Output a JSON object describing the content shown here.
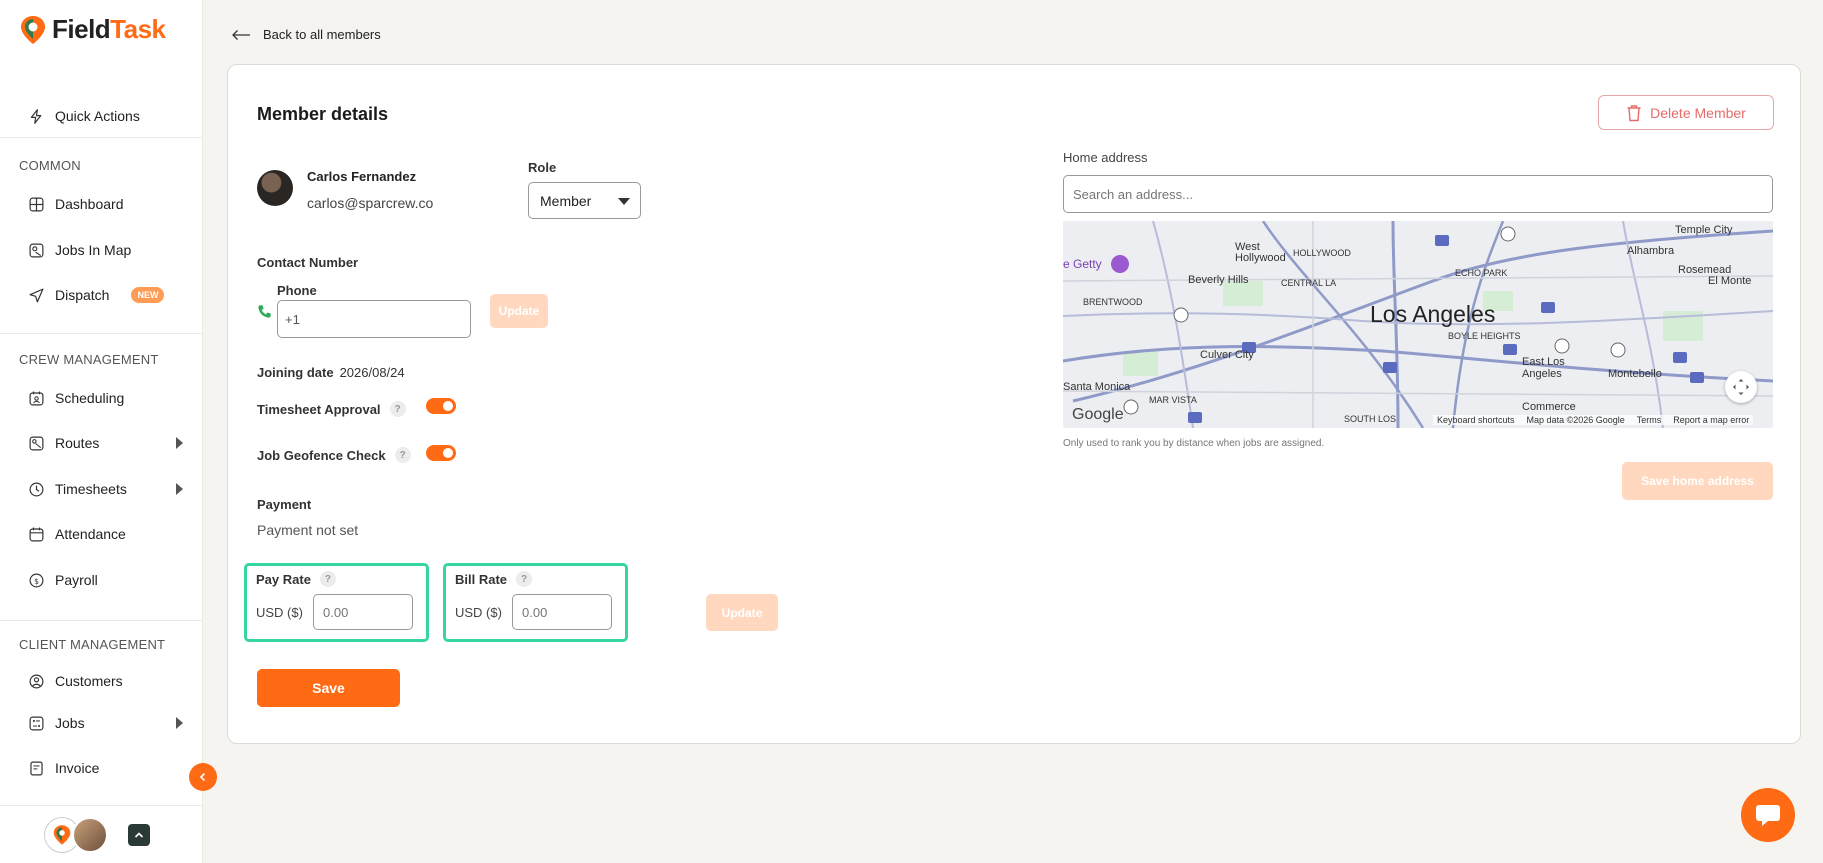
{
  "app": {
    "logo_text_a": "Field",
    "logo_text_b": "Task"
  },
  "sidebar": {
    "quick_actions": "Quick Actions",
    "sections": {
      "common": "COMMON",
      "crew": "CREW MANAGEMENT",
      "client": "CLIENT MANAGEMENT"
    },
    "items": {
      "dashboard": "Dashboard",
      "jobs_in_map": "Jobs In Map",
      "dispatch": "Dispatch",
      "dispatch_badge": "NEW",
      "scheduling": "Scheduling",
      "routes": "Routes",
      "timesheets": "Timesheets",
      "attendance": "Attendance",
      "payroll": "Payroll",
      "customers": "Customers",
      "jobs": "Jobs",
      "invoice": "Invoice"
    }
  },
  "main": {
    "back_link": "Back to all members",
    "title": "Member details",
    "delete_label": "Delete Member",
    "member": {
      "name": "Carlos Fernandez",
      "email": "carlos@sparcrew.co"
    },
    "role": {
      "label": "Role",
      "value": "Member"
    },
    "contact": {
      "label": "Contact Number",
      "phone_label": "Phone",
      "phone_value": "+1",
      "update_label": "Update"
    },
    "joining": {
      "label": "Joining date",
      "value": "2026/08/24"
    },
    "timesheet_approval": {
      "label": "Timesheet Approval",
      "enabled": true
    },
    "job_geofence": {
      "label": "Job Geofence Check",
      "enabled": true
    },
    "payment": {
      "label": "Payment",
      "status": "Payment not set",
      "pay_rate_label": "Pay Rate",
      "bill_rate_label": "Bill Rate",
      "currency": "USD ($)",
      "pay_placeholder": "0.00",
      "bill_placeholder": "0.00",
      "update_label": "Update"
    },
    "save_label": "Save",
    "home": {
      "label": "Home address",
      "placeholder": "Search an address...",
      "note": "Only used to rank you by distance when jobs are assigned.",
      "save_label": "Save home address"
    },
    "map": {
      "city": "Los Angeles",
      "places": [
        "Temple City",
        "West Hollywood",
        "HOLLYWOOD",
        "Alhambra",
        "ECHO PARK",
        "Rosemead",
        "e Getty",
        "Beverly Hills",
        "CENTRAL LA",
        "El Monte",
        "BRENTWOOD",
        "BOYLE HEIGHTS",
        "Culver City",
        "East Los Angeles",
        "Montebello",
        "Santa Monica",
        "MAR VISTA",
        "Commerce",
        "SOUTH LOS"
      ],
      "google": "Google",
      "footer": [
        "Keyboard shortcuts",
        "Map data ©2026 Google",
        "Terms",
        "Report a map error"
      ]
    }
  },
  "colors": {
    "accent": "#ff6a14",
    "highlight": "#35d6a1",
    "disabled": "#ffd8bf"
  }
}
